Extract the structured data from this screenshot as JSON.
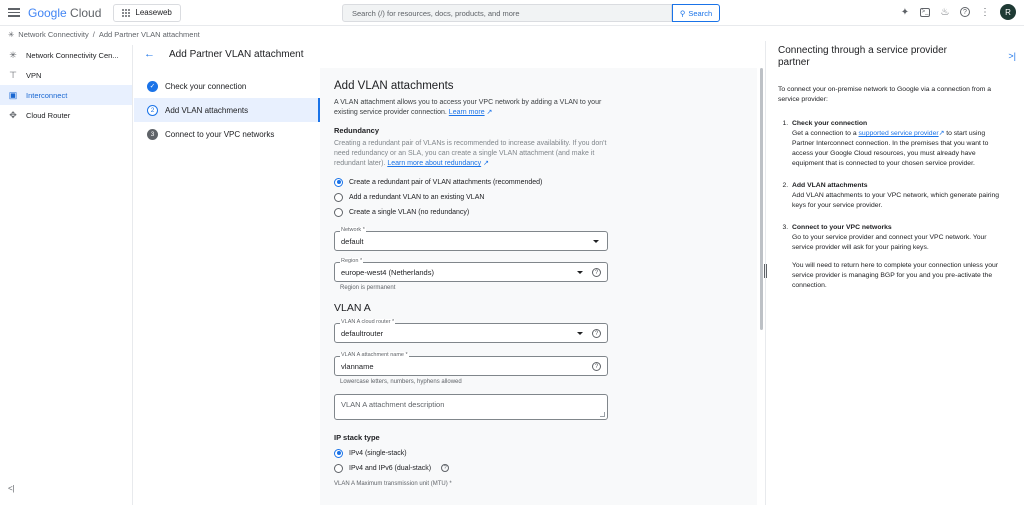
{
  "header": {
    "logo_google": "Google",
    "logo_cloud": "Cloud",
    "project": "Leaseweb",
    "search_placeholder": "Search (/) for resources, docs, products, and more",
    "search_button": "Search",
    "avatar_letter": "R"
  },
  "breadcrumb": [
    "Network Connectivity",
    "/",
    "Add Partner VLAN attachment"
  ],
  "leftnav": {
    "items": [
      {
        "label": "Network Connectivity Cen...",
        "icon": "hub-icon"
      },
      {
        "label": "VPN",
        "icon": "vpn-icon"
      },
      {
        "label": "Interconnect",
        "icon": "interconnect-icon"
      },
      {
        "label": "Cloud Router",
        "icon": "router-icon"
      }
    ]
  },
  "page": {
    "title": "Add Partner VLAN attachment",
    "steps": [
      {
        "num": "✓",
        "label": "Check your connection"
      },
      {
        "num": "2",
        "label": "Add VLAN attachments"
      },
      {
        "num": "3",
        "label": "Connect to your VPC networks"
      }
    ]
  },
  "form": {
    "heading": "Add VLAN attachments",
    "intro": "A VLAN attachment allows you to access your VPC network by adding a VLAN to your existing service provider connection.",
    "learn_more": "Learn more",
    "redundancy_label": "Redundancy",
    "redundancy_text": "Creating a redundant pair of VLANs is recommended to increase availability. If you don't need redundancy or an SLA, you can create a single VLAN attachment (and make it redundant later).",
    "learn_more_redundancy": "Learn more about redundancy",
    "options": [
      "Create a redundant pair of VLAN attachments (recommended)",
      "Add a redundant VLAN to an existing VLAN",
      "Create a single VLAN (no redundancy)"
    ],
    "network_label": "Network *",
    "network_value": "default",
    "region_label": "Region *",
    "region_value": "europe-west4 (Netherlands)",
    "region_hint": "Region is permanent",
    "vlan_a_heading": "VLAN A",
    "router_label": "VLAN A cloud router *",
    "router_value": "defaultrouter",
    "name_label": "VLAN A attachment name *",
    "name_value": "vlanname",
    "name_hint": "Lowercase letters, numbers, hyphens allowed",
    "desc_placeholder": "VLAN A attachment description",
    "ip_stack_label": "IP stack type",
    "ip_options": [
      "IPv4 (single-stack)",
      "IPv4 and IPv6 (dual-stack)"
    ],
    "mtu_cutoff": "VLAN A Maximum transmission unit (MTU) *"
  },
  "panel": {
    "title": "Connecting through a service provider partner",
    "intro": "To connect your on-premise network to Google via a connection from a service provider:",
    "step1_title": "Check your connection",
    "step1_a": "Get a connection to a",
    "step1_link": "supported service provider",
    "step1_b": "to start using Partner Interconnect connection. In the premises that you want to access your Google Cloud resources, you must already have equipment that is connected to your chosen service provider.",
    "step2_title": "Add VLAN attachments",
    "step2_text": "Add VLAN attachments to your VPC network, which generate pairing keys for your service provider.",
    "step3_title": "Connect to your VPC networks",
    "step3_text": "Go to your service provider and connect your VPC network. Your service provider will ask for your pairing keys.",
    "step3_note": "You will need to return here to complete your connection unless your service provider is managing BGP for you and you pre-activate the connection."
  }
}
